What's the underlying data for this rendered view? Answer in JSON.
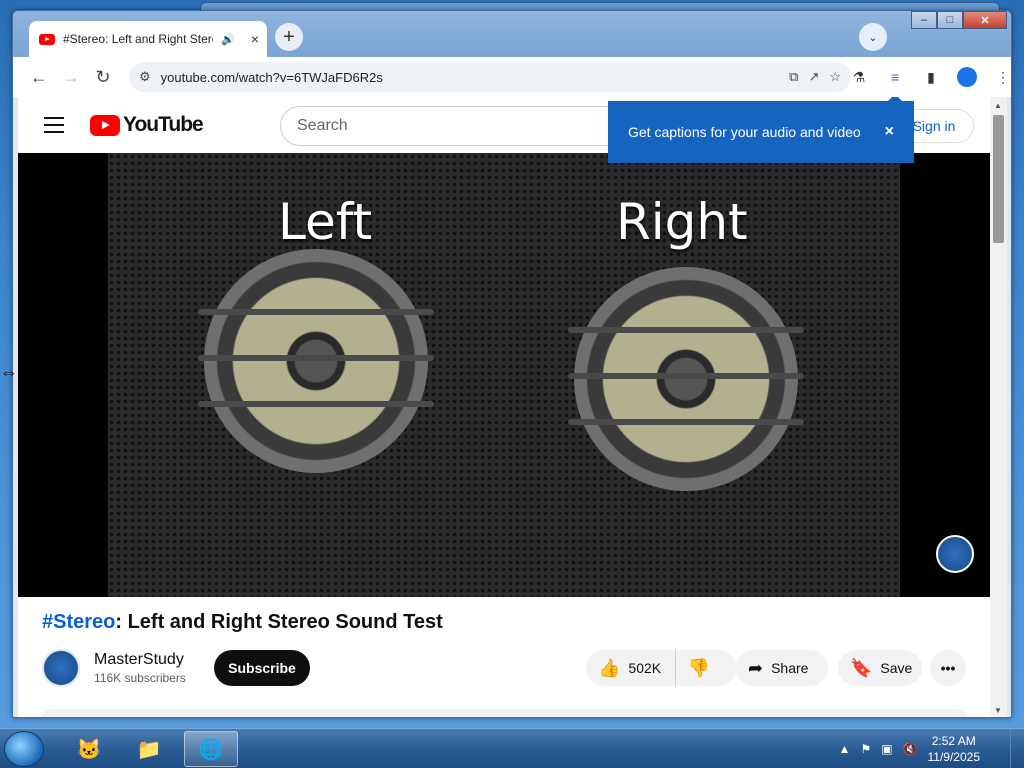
{
  "browser": {
    "tab": {
      "title": "#Stereo: Left and Right Stereo Sound Test",
      "audio_icon": "speaker-icon",
      "close": "×"
    },
    "new_tab": "+",
    "tab_search": "⌄",
    "window_controls": {
      "minimize": "–",
      "maximize": "□",
      "close": "✕"
    },
    "url": "youtube.com/watch?v=6TWJaFD6R2s",
    "nav": {
      "back": "←",
      "forward": "→",
      "reload": "↻"
    }
  },
  "youtube": {
    "logo_text": "YouTube",
    "search_placeholder": "Search",
    "sign_in": "Sign in",
    "callout": {
      "text": "Get captions for your audio and video",
      "close": "×"
    },
    "video": {
      "left_label": "Left",
      "right_label": "Right"
    },
    "title_hashtag": "#Stereo",
    "title_rest": ": Left and Right Stereo Sound Test",
    "channel": {
      "name": "MasterStudy",
      "subscribers": "116K subscribers"
    },
    "subscribe": "Subscribe",
    "likes": "502K",
    "share": "Share",
    "save": "Save",
    "more": "•••"
  },
  "taskbar": {
    "clock_time": "2:52 AM",
    "clock_date": "11/9/2025"
  }
}
